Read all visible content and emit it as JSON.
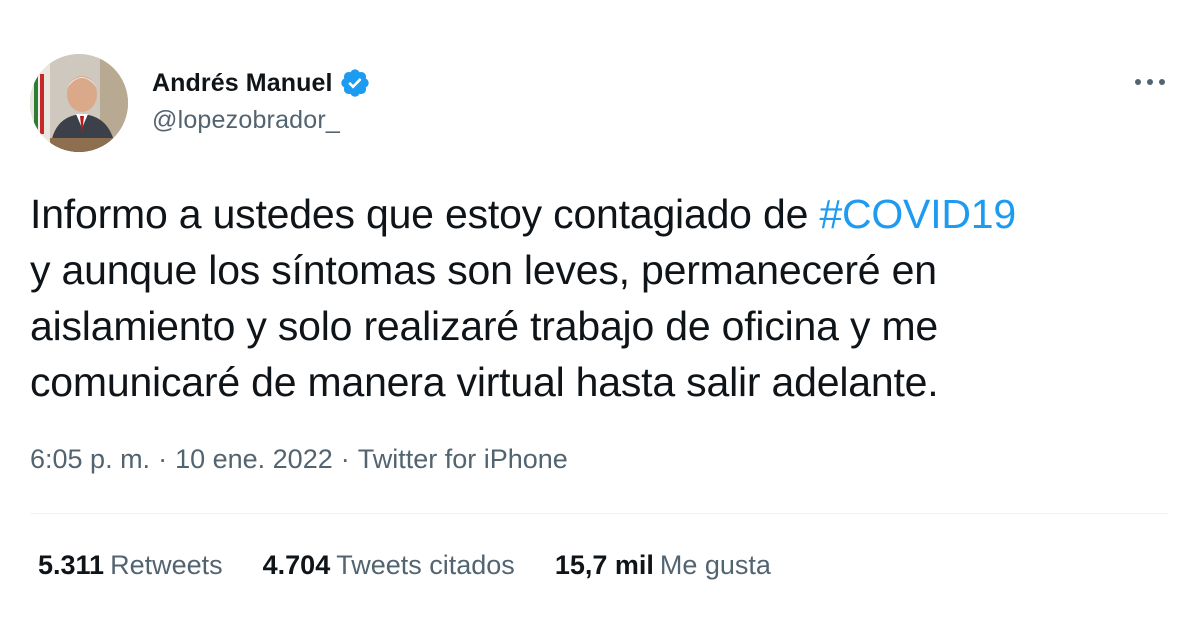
{
  "author": {
    "name": "Andrés Manuel",
    "handle": "@lopezobrador_",
    "verified_color": "#1d9bf0"
  },
  "tweet": {
    "lines": [
      {
        "text": "Informo a ustedes que estoy contagiado de ",
        "hashtag": "#COVID19"
      },
      {
        "text": "y aunque los síntomas son leves, permaneceré en"
      },
      {
        "text": "aislamiento y solo realizaré trabajo de oficina y me"
      },
      {
        "text": "comunicaré de manera virtual hasta salir adelante."
      }
    ]
  },
  "meta": {
    "time": "6:05 p. m.",
    "separator": "·",
    "date": "10 ene. 2022",
    "source": "Twitter for iPhone"
  },
  "stats": [
    {
      "count": "5.311",
      "label": "Retweets"
    },
    {
      "count": "4.704",
      "label": "Tweets citados"
    },
    {
      "count": "15,7 mil",
      "label": "Me gusta"
    }
  ],
  "colors": {
    "text": "#0f1419",
    "secondary": "#536471",
    "accent": "#1d9bf0",
    "divider": "#eff3f4"
  },
  "icons": {
    "verified": "verified-badge-icon",
    "more": "more-options-icon"
  }
}
